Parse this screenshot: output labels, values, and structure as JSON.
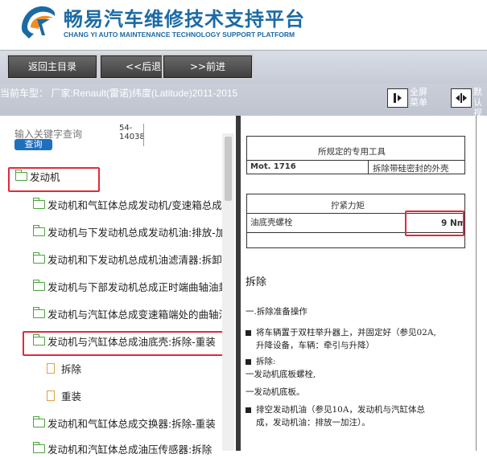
{
  "header": {
    "title": "畅易汽车维修技术支持平台",
    "subtitle": "CHANG YI AUTO MAINTENANCE TECHNOLOGY SUPPORT PLATFORM",
    "logo_icon": "cy-logo-icon"
  },
  "nav": {
    "home": "返回主目录",
    "back": "<<后退.",
    "forward": ">>前进"
  },
  "vehicle": {
    "label": "当前车型： 厂家:Renault(雷诺)纬度(Latitude)2011-2015",
    "fullscreen_l1": "全屏",
    "fullscreen_l2": "菜单",
    "restore_l1": "默认",
    "restore_l2": "视图"
  },
  "search": {
    "hint": "输入关键字查询",
    "button": "查询",
    "code_l1": "54-",
    "code_l2": "14038"
  },
  "tree": [
    {
      "label": "发动机",
      "icon": "folder-open-icon"
    },
    {
      "label": "发动机和气缸体总成发动机/变速箱总成"
    },
    {
      "label": "发动机与下发动机总成发动机油:排放-加注"
    },
    {
      "label": "发动机和下发动机总成机油滤清器:拆卸-重装"
    },
    {
      "label": "发动机与下部发动机总成正时端曲轴油封"
    },
    {
      "label": "发动机与汽缸体总成变速箱端处的曲轴油封"
    },
    {
      "label": "发动机与汽缸体总成油底壳:拆除-重装",
      "icon": "folder-open-icon"
    },
    {
      "label": "拆除",
      "icon": "document-icon"
    },
    {
      "label": "重装",
      "icon": "document-icon"
    },
    {
      "label": "发动机和气缸体总成交换器:拆除-重装"
    },
    {
      "label": "发动机和汽缸体总成油压传感器:拆除"
    }
  ],
  "doc": {
    "tools_header": "所规定的专用工具",
    "tool_code": "Mot. 1716",
    "tool_desc": "拆除带硅密封的外壳",
    "torque_header": "拧紧力矩",
    "torque_item": "油底壳螺栓",
    "torque_value": "9 Nm",
    "section_title": "拆除",
    "step_title": "一.拆除准备操作",
    "bullet1_l1": "将车辆置于双柱举升器上，并固定好（参见02A,",
    "bullet1_l2": "升降设备，车辆：牵引与升降）",
    "bullet2": "拆除:",
    "line3": "一发动机底板螺栓,",
    "line4": "一发动机底板。",
    "bullet3_l1": "排空发动机油（参见10A，发动机与汽缸体总",
    "bullet3_l2": "成，发动机油：排放一加注）。"
  },
  "colors": {
    "brand_blue": "#1b6aa5",
    "highlight_red": "#e02a3a",
    "folder_green": "#4aa53a",
    "doc_orange": "#e0a040"
  }
}
